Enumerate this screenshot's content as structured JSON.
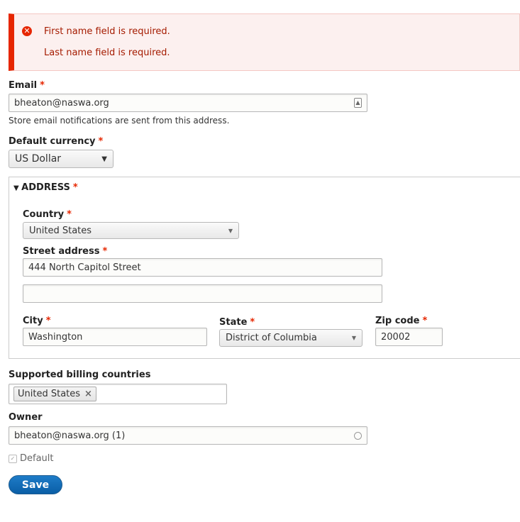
{
  "errors": [
    "First name field is required.",
    "Last name field is required."
  ],
  "email": {
    "label": "Email",
    "required": "*",
    "value": "bheaton@naswa.org",
    "description": "Store email notifications are sent from this address."
  },
  "currency": {
    "label": "Default currency",
    "required": "*",
    "value": "US Dollar"
  },
  "address": {
    "legend": "ADDRESS",
    "required": "*",
    "country": {
      "label": "Country",
      "value": "United States"
    },
    "street": {
      "label": "Street address",
      "line1": "444 North Capitol Street",
      "line2": ""
    },
    "city": {
      "label": "City",
      "value": "Washington"
    },
    "state": {
      "label": "State",
      "value": "District of Columbia"
    },
    "zip": {
      "label": "Zip code",
      "value": "20002"
    }
  },
  "billing": {
    "label": "Supported billing countries",
    "tags": [
      "United States"
    ],
    "remove": "×"
  },
  "owner": {
    "label": "Owner",
    "value": "bheaton@naswa.org (1)"
  },
  "default": {
    "label": "Default",
    "checked": true
  },
  "save_label": "Save"
}
